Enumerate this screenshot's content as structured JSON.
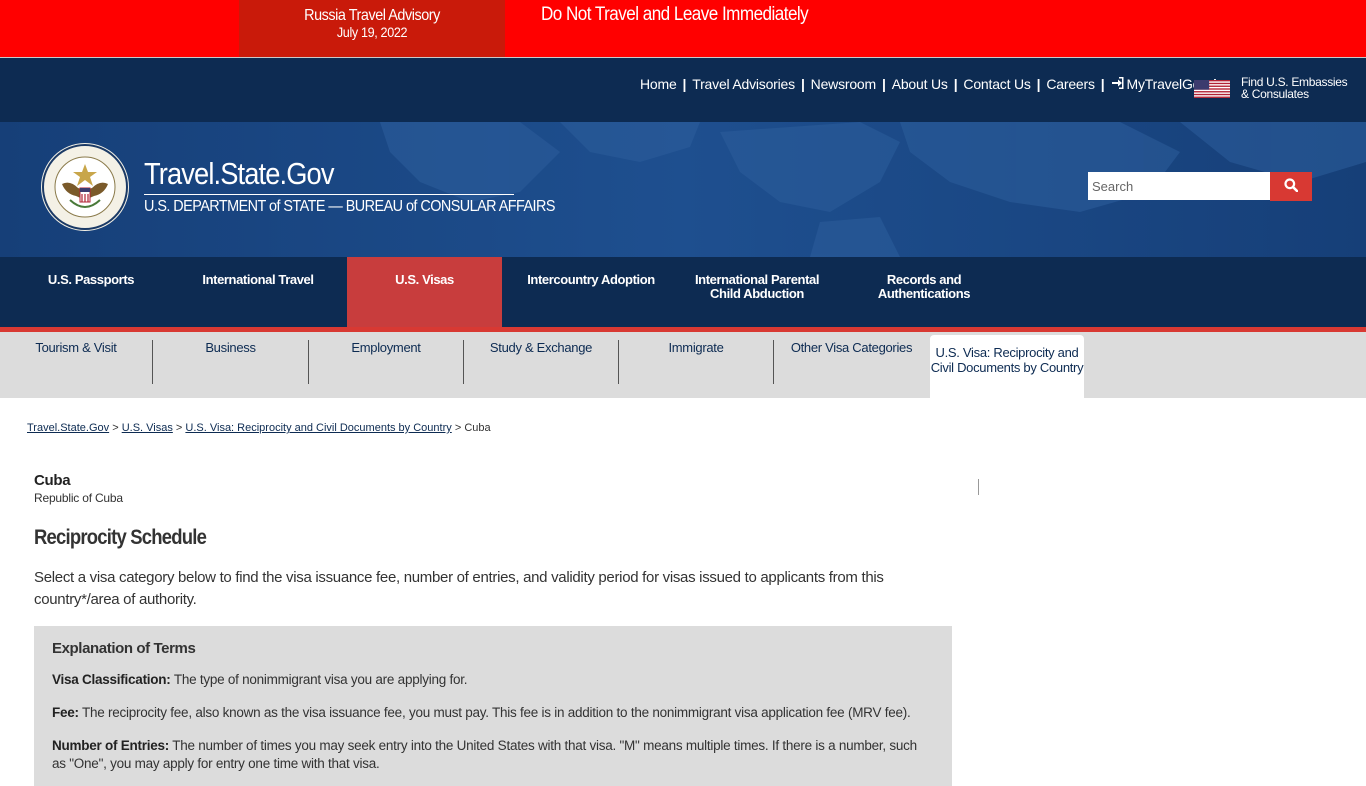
{
  "alert": {
    "advisory_title": "Russia Travel Advisory",
    "advisory_date": "July 19, 2022",
    "message": "Do Not Travel and Leave Immediately"
  },
  "utility_nav": {
    "items": [
      "Home",
      "Travel Advisories",
      "Newsroom",
      "About Us",
      "Contact Us",
      "Careers",
      "MyTravelGov"
    ],
    "separator": "|",
    "embassies_line1": "Find U.S. Embassies",
    "embassies_line2": "& Consulates"
  },
  "header": {
    "site_title": "Travel.State.Gov",
    "subtitle": "U.S. DEPARTMENT of STATE — BUREAU of CONSULAR AFFAIRS",
    "search_placeholder": "Search"
  },
  "main_nav": {
    "items": [
      "U.S. Passports",
      "International Travel",
      "U.S. Visas",
      "Intercountry Adoption",
      "International Parental Child Abduction",
      "Records and Authentications"
    ],
    "active": "U.S. Visas"
  },
  "sub_nav": {
    "items": [
      "Tourism & Visit",
      "Business",
      "Employment",
      "Study & Exchange",
      "Immigrate",
      "Other Visa Categories"
    ],
    "active": "U.S. Visa: Reciprocity and Civil Documents by Country"
  },
  "breadcrumb": {
    "items": [
      "Travel.State.Gov",
      "U.S. Visas",
      "U.S. Visa: Reciprocity and Civil Documents by Country"
    ],
    "current": "Cuba",
    "separator": ">"
  },
  "content": {
    "country": "Cuba",
    "country_full": "Republic of Cuba",
    "heading": "Reciprocity Schedule",
    "intro": "Select a visa category below to find the visa issuance fee, number of entries, and validity period for visas issued to applicants from this country*/area of authority.",
    "terms": {
      "title": "Explanation of Terms",
      "items": [
        {
          "term": "Visa Classification:",
          "text": " The type of nonimmigrant visa you are applying for."
        },
        {
          "term": "Fee:",
          "text": " The reciprocity fee, also known as the visa issuance fee, you must pay. This fee is in addition to the nonimmigrant visa application fee (MRV fee)."
        },
        {
          "term": "Number of Entries:",
          "text": " The number of times you may seek entry into the United States with that visa. \"M\" means multiple times. If there is a number, such as \"One\", you may apply for entry one time with that visa."
        }
      ]
    }
  },
  "colors": {
    "alert_red": "#ff0000",
    "advisory_red": "#c91a0a",
    "navy": "#0d2b52",
    "banner_blue": "#1b4b8a",
    "accent_red": "#d83933",
    "subnav_gray": "#dcdcdc"
  },
  "icons": {
    "search": "search-icon",
    "login": "sign-in-icon",
    "flag": "us-flag-icon",
    "seal": "department-of-state-seal"
  }
}
